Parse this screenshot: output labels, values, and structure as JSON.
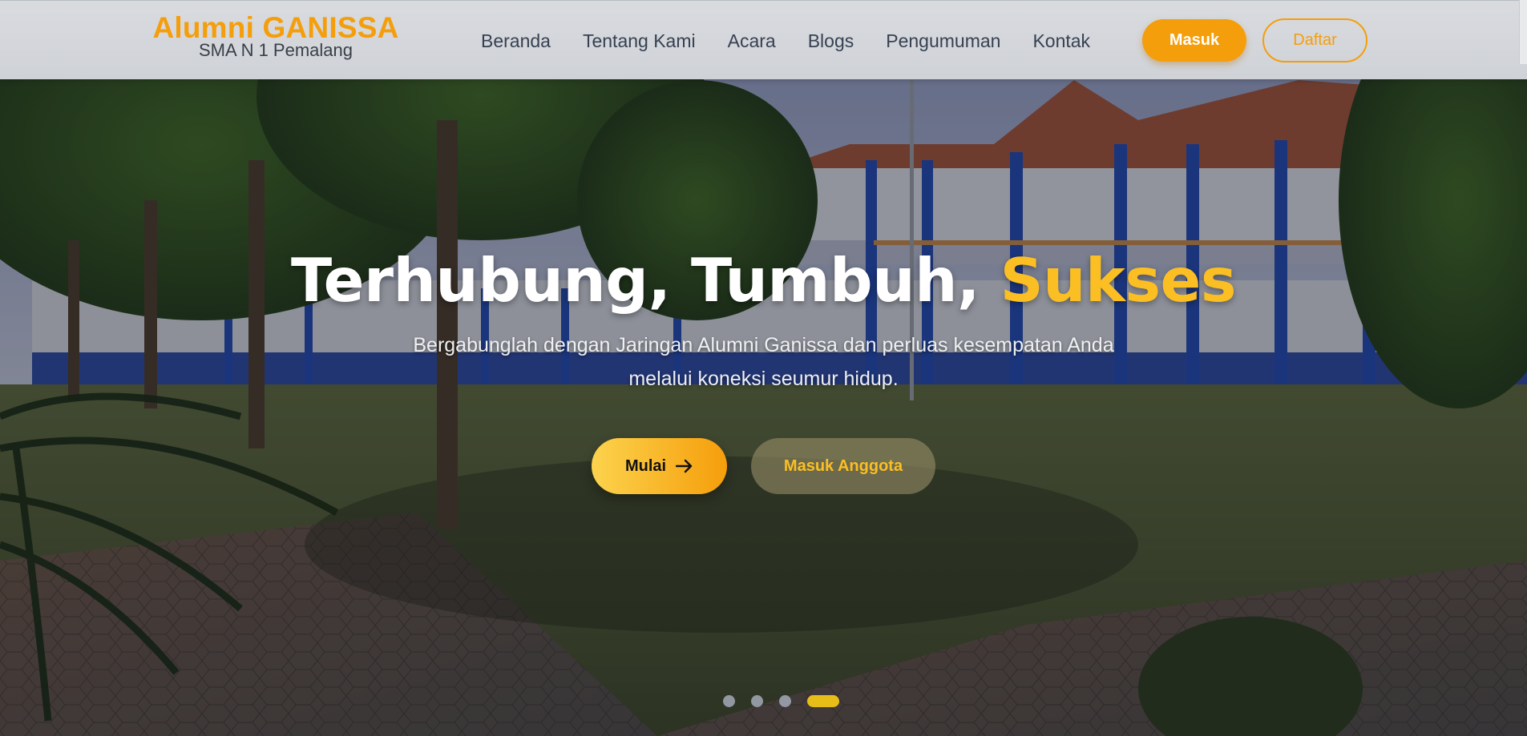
{
  "brand": {
    "title": "Alumni GANISSA",
    "subtitle": "SMA N 1 Pemalang"
  },
  "nav": {
    "items": [
      {
        "label": "Beranda"
      },
      {
        "label": "Tentang Kami"
      },
      {
        "label": "Acara"
      },
      {
        "label": "Blogs"
      },
      {
        "label": "Pengumuman"
      },
      {
        "label": "Kontak"
      }
    ],
    "login_label": "Masuk",
    "register_label": "Daftar"
  },
  "hero": {
    "headline_part1": "Terhubung, Tumbuh,",
    "headline_accent": "Sukses",
    "subtitle": "Bergabunglah dengan Jaringan Alumni Ganissa dan perluas kesempatan Anda melalui koneksi seumur hidup.",
    "primary_cta": "Mulai",
    "secondary_cta": "Masuk Anggota",
    "primary_cta_icon": "arrow-right-icon",
    "background_image": "school-courtyard-photo",
    "carousel": {
      "slide_count": 4,
      "active_slide": 4
    }
  },
  "colors": {
    "accent": "#f59e0b",
    "accent_light": "#fbbf24",
    "nav_text": "#374151",
    "navbar_bg": "#d4d6da"
  }
}
